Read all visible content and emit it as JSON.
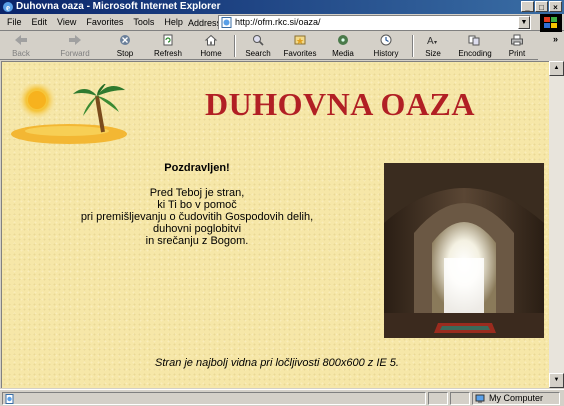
{
  "window": {
    "title": "Duhovna oaza - Microsoft Internet Explorer",
    "min_label": "_",
    "max_label": "□",
    "close_label": "×"
  },
  "menu": {
    "items": [
      "File",
      "Edit",
      "View",
      "Favorites",
      "Tools",
      "Help"
    ]
  },
  "address": {
    "label": "Address",
    "url": "http://ofm.rkc.si/oaza/"
  },
  "toolbar": {
    "back": "Back",
    "forward": "Forward",
    "stop": "Stop",
    "refresh": "Refresh",
    "home": "Home",
    "search": "Search",
    "favorites": "Favorites",
    "media": "Media",
    "history": "History",
    "size": "Size",
    "encoding": "Encoding",
    "print": "Print",
    "more": "»"
  },
  "page": {
    "title": "DUHOVNA OAZA",
    "greeting": "Pozdravljen!",
    "verse_lines": [
      "Pred Teboj je stran,",
      "ki Ti bo v pomoč",
      "pri premišljevanju o čudovitih Gospodovih delih,",
      "duhovni poglobitvi",
      "in srečanju z Bogom."
    ],
    "footer_note": "Stran je najbolj vidna pri ločljivosti 800x600 z IE 5."
  },
  "status": {
    "zone": "My Computer"
  },
  "colors": {
    "title_red": "#b11f24",
    "page_background": "#f6e7a8",
    "titlebar_blue": "#0a246a"
  }
}
